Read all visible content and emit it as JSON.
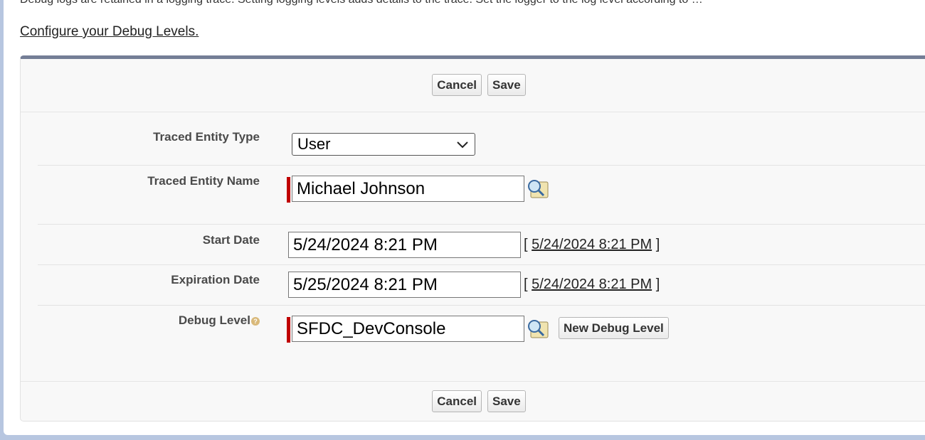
{
  "header": {
    "cut_text": "Debug logs are retained in a logging trace. Setting logging levels adds details to the trace. Set the logger to the log level according to …",
    "configure_link": "Configure your Debug Levels."
  },
  "buttons": {
    "cancel": "Cancel",
    "save": "Save",
    "new_debug_level": "New Debug Level"
  },
  "form": {
    "traced_entity_type": {
      "label": "Traced Entity Type",
      "value": "User"
    },
    "traced_entity_name": {
      "label": "Traced Entity Name",
      "value": "Michael Johnson"
    },
    "start_date": {
      "label": "Start Date",
      "value": "5/24/2024 8:21 PM",
      "link": "5/24/2024 8:21 PM"
    },
    "expiration_date": {
      "label": "Expiration Date",
      "value": "5/25/2024 8:21 PM",
      "link": "5/24/2024 8:21 PM"
    },
    "debug_level": {
      "label": "Debug Level",
      "value": "SFDC_DevConsole",
      "help": "?"
    }
  },
  "brackets": {
    "open": "[ ",
    "close": " ]"
  },
  "colors": {
    "panel_top_border": "#747e96",
    "required_bar": "#c00000",
    "side_background": "#b7c6e0"
  }
}
